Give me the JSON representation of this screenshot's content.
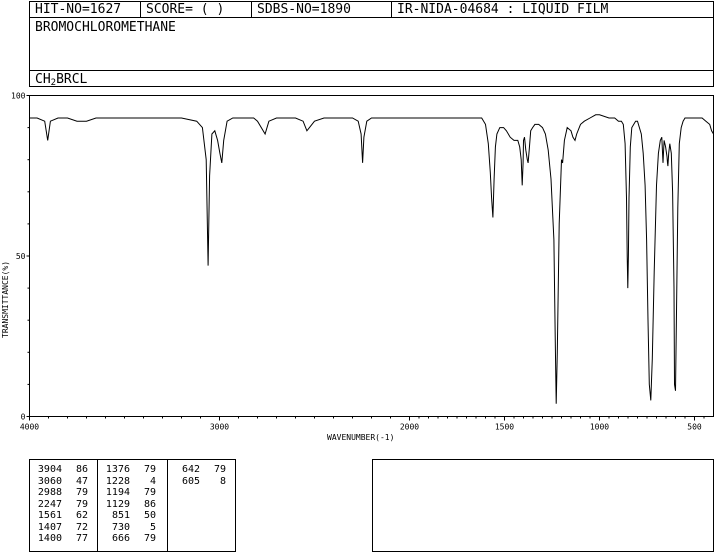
{
  "header": {
    "hit_no": "HIT-NO=1627",
    "score": "SCORE=  (   )",
    "sdbs_no": "SDBS-NO=1890",
    "ir_code": "IR-NIDA-04684 : LIQUID FILM",
    "compound_name": "BROMOCHLOROMETHANE",
    "formula_main": "CH",
    "formula_sub": "2",
    "formula_rest": "BRCL"
  },
  "chart_data": {
    "type": "line",
    "xlabel": "WAVENUMBER(-1)",
    "ylabel": "TRANSMITTANCE(%)",
    "xlim": [
      4000,
      400
    ],
    "ylim": [
      0,
      100
    ],
    "x_ticks": [
      4000,
      3000,
      2000,
      1500,
      1000,
      500
    ],
    "y_ticks": [
      0,
      50,
      100
    ],
    "grid": false,
    "series": [
      {
        "x": [
          4000,
          3960,
          3920,
          3904,
          3890,
          3850,
          3800,
          3750,
          3700,
          3650,
          3600,
          3500,
          3400,
          3300,
          3200,
          3120,
          3090,
          3070,
          3060,
          3052,
          3040,
          3025,
          3010,
          2998,
          2988,
          2978,
          2960,
          2930,
          2900,
          2850,
          2820,
          2800,
          2760,
          2740,
          2700,
          2650,
          2600,
          2560,
          2540,
          2500,
          2450,
          2400,
          2350,
          2300,
          2270,
          2255,
          2247,
          2240,
          2225,
          2200,
          2150,
          2100,
          2000,
          1900,
          1800,
          1700,
          1650,
          1620,
          1600,
          1585,
          1575,
          1568,
          1561,
          1555,
          1548,
          1540,
          1525,
          1505,
          1490,
          1470,
          1450,
          1430,
          1420,
          1412,
          1407,
          1402,
          1400,
          1395,
          1388,
          1380,
          1376,
          1370,
          1362,
          1352,
          1340,
          1320,
          1300,
          1285,
          1270,
          1255,
          1240,
          1233,
          1228,
          1222,
          1212,
          1200,
          1194,
          1185,
          1170,
          1150,
          1140,
          1129,
          1120,
          1100,
          1080,
          1050,
          1020,
          1000,
          950,
          920,
          900,
          885,
          875,
          865,
          858,
          854,
          851,
          848,
          845,
          838,
          830,
          810,
          800,
          790,
          780,
          770,
          760,
          752,
          745,
          738,
          730,
          722,
          712,
          700,
          690,
          680,
          672,
          666,
          660,
          652,
          645,
          642,
          640,
          636,
          630,
          622,
          615,
          608,
          605,
          600,
          595,
          588,
          580,
          570,
          560,
          550,
          540,
          520,
          500,
          480,
          460,
          440,
          420,
          410,
          400
        ],
        "values": [
          93,
          93,
          92,
          86,
          92,
          93,
          93,
          92,
          92,
          93,
          93,
          93,
          93,
          93,
          93,
          92,
          90,
          80,
          47,
          75,
          88,
          89,
          86,
          82,
          79,
          86,
          92,
          93,
          93,
          93,
          93,
          92,
          88,
          92,
          93,
          93,
          93,
          92,
          89,
          92,
          93,
          93,
          93,
          93,
          92,
          88,
          79,
          87,
          92,
          93,
          93,
          93,
          93,
          93,
          93,
          93,
          93,
          93,
          91,
          85,
          76,
          68,
          62,
          74,
          84,
          88,
          90,
          90,
          89,
          87,
          86,
          86,
          84,
          80,
          72,
          79,
          86,
          87,
          83,
          80,
          79,
          83,
          89,
          90,
          91,
          91,
          90,
          88,
          83,
          74,
          55,
          25,
          4,
          20,
          60,
          80,
          79,
          86,
          90,
          89,
          87,
          86,
          88,
          91,
          92,
          93,
          94,
          94,
          93,
          93,
          92,
          92,
          91,
          85,
          68,
          50,
          40,
          50,
          68,
          84,
          90,
          92,
          92,
          90,
          88,
          82,
          72,
          55,
          30,
          10,
          5,
          18,
          45,
          72,
          82,
          86,
          87,
          79,
          86,
          84,
          81,
          79,
          78,
          82,
          85,
          82,
          70,
          40,
          10,
          8,
          30,
          65,
          85,
          90,
          92,
          93,
          93,
          93,
          93,
          93,
          93,
          92,
          91,
          89,
          88
        ]
      }
    ]
  },
  "peak_table": {
    "columns": [
      [
        [
          "3904",
          "86"
        ],
        [
          "3060",
          "47"
        ],
        [
          "2988",
          "79"
        ],
        [
          "2247",
          "79"
        ],
        [
          "1561",
          "62"
        ],
        [
          "1407",
          "72"
        ],
        [
          "1400",
          "77"
        ]
      ],
      [
        [
          "1376",
          "79"
        ],
        [
          "1228",
          "4"
        ],
        [
          "1194",
          "79"
        ],
        [
          "1129",
          "86"
        ],
        [
          "851",
          "50"
        ],
        [
          "730",
          "5"
        ],
        [
          "666",
          "79"
        ]
      ],
      [
        [
          "642",
          "79"
        ],
        [
          "605",
          "8"
        ]
      ]
    ]
  }
}
